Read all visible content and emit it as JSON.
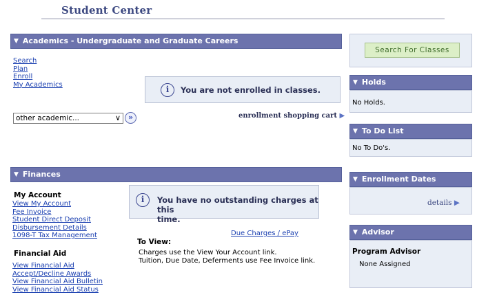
{
  "page": {
    "title": "Student Center"
  },
  "academics": {
    "header": "Academics - Undergraduate and Graduate Careers",
    "links": [
      "Search",
      "Plan",
      "Enroll",
      "My Academics"
    ],
    "notice": "You are not enrolled in classes.",
    "dropdown": {
      "value": "other academic..."
    },
    "cart_link": "enrollment shopping cart"
  },
  "finances": {
    "header": "Finances",
    "my_account": {
      "title": "My Account",
      "links": [
        "View My Account",
        "Fee Invoice",
        "Student Direct Deposit",
        "Disbursement Details",
        "1098-T Tax Management"
      ]
    },
    "financial_aid": {
      "title": "Financial Aid",
      "links": [
        "View Financial Aid",
        "Accept/Decline Awards",
        "View Financial Aid Bulletin",
        "View Financial Aid Status"
      ]
    },
    "notice": {
      "line1": "You have no outstanding charges at this",
      "line2": "time."
    },
    "due_link": "Due Charges / ePay",
    "to_view_label": "To View:",
    "to_view_lines": [
      "Charges use the View Your Account link.",
      "Tuition, Due Date, Deferments use Fee Invoice link."
    ]
  },
  "sidebar": {
    "search_button": "Search For Classes",
    "holds": {
      "header": "Holds",
      "text": "No Holds."
    },
    "todo": {
      "header": "To Do List",
      "text": "No To Do's."
    },
    "enrollment_dates": {
      "header": "Enrollment Dates",
      "details_link": "details"
    },
    "advisor": {
      "header": "Advisor",
      "role": "Program Advisor",
      "name": "None Assigned"
    }
  }
}
